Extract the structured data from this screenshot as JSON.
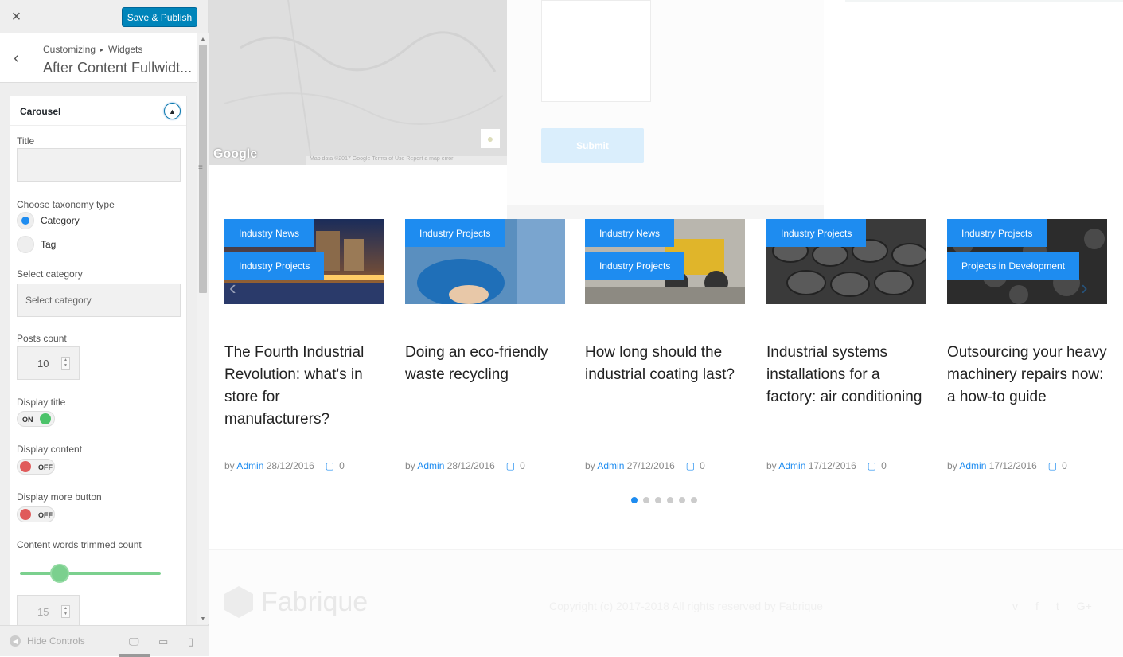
{
  "topbar": {
    "close": "×",
    "save_label": "Save & Publish"
  },
  "header": {
    "back": "‹",
    "breadcrumb_1": "Customizing",
    "breadcrumb_sep": "▸",
    "breadcrumb_2": "Widgets",
    "section_title": "After Content Fullwidt..."
  },
  "widget": {
    "title": "Carousel",
    "title_label": "Title",
    "title_value": "",
    "taxonomy_label": "Choose taxonomy type",
    "taxonomy_options": [
      "Category",
      "Tag"
    ],
    "taxonomy_selected": "Category",
    "category_label": "Select category",
    "category_placeholder": "Select category",
    "posts_count_label": "Posts count",
    "posts_count": "10",
    "display_title_label": "Display title",
    "display_title_state": "ON",
    "display_content_label": "Display content",
    "display_content_state": "OFF",
    "display_more_label": "Display more button",
    "display_more_state": "OFF",
    "trim_label": "Content words trimmed count",
    "trim_value": "15"
  },
  "bottom": {
    "hide_controls": "Hide Controls"
  },
  "map": {
    "google": "Google",
    "footer": "Map data ©2017 Google   Terms of Use   Report a map error"
  },
  "form": {
    "submit": "Submit"
  },
  "posts": [
    {
      "tags": [
        "Industry News",
        "Industry Projects"
      ],
      "title": "The Fourth Industrial Revolution: what's in store for manufacturers?",
      "by": "by",
      "author": "Admin",
      "date": "28/12/2016",
      "comments": "0"
    },
    {
      "tags": [
        "Industry Projects"
      ],
      "title": "Doing an eco-friendly waste recycling",
      "by": "by",
      "author": "Admin",
      "date": "28/12/2016",
      "comments": "0"
    },
    {
      "tags": [
        "Industry News",
        "Industry Projects"
      ],
      "title": "How long should the industrial coating last?",
      "by": "by",
      "author": "Admin",
      "date": "27/12/2016",
      "comments": "0"
    },
    {
      "tags": [
        "Industry Projects"
      ],
      "title": "Industrial systems installations for a factory: air conditioning",
      "by": "by",
      "author": "Admin",
      "date": "17/12/2016",
      "comments": "0"
    },
    {
      "tags": [
        "Industry Projects",
        "Projects in Development"
      ],
      "title": "Outsourcing your heavy machinery repairs now: a how-to guide",
      "by": "by",
      "author": "Admin",
      "date": "17/12/2016",
      "comments": "0"
    }
  ],
  "pagination": {
    "count": 6,
    "active": 1
  },
  "footer": {
    "logo_text": "Fabrique",
    "copyright": "Copyright (c) 2017-2018 All rights reserved by Fabrique"
  },
  "colors": {
    "accent": "#1e8cf0",
    "wp_button": "#0085ba",
    "toggle_on": "#4cc36a",
    "toggle_off": "#e05a5a"
  }
}
